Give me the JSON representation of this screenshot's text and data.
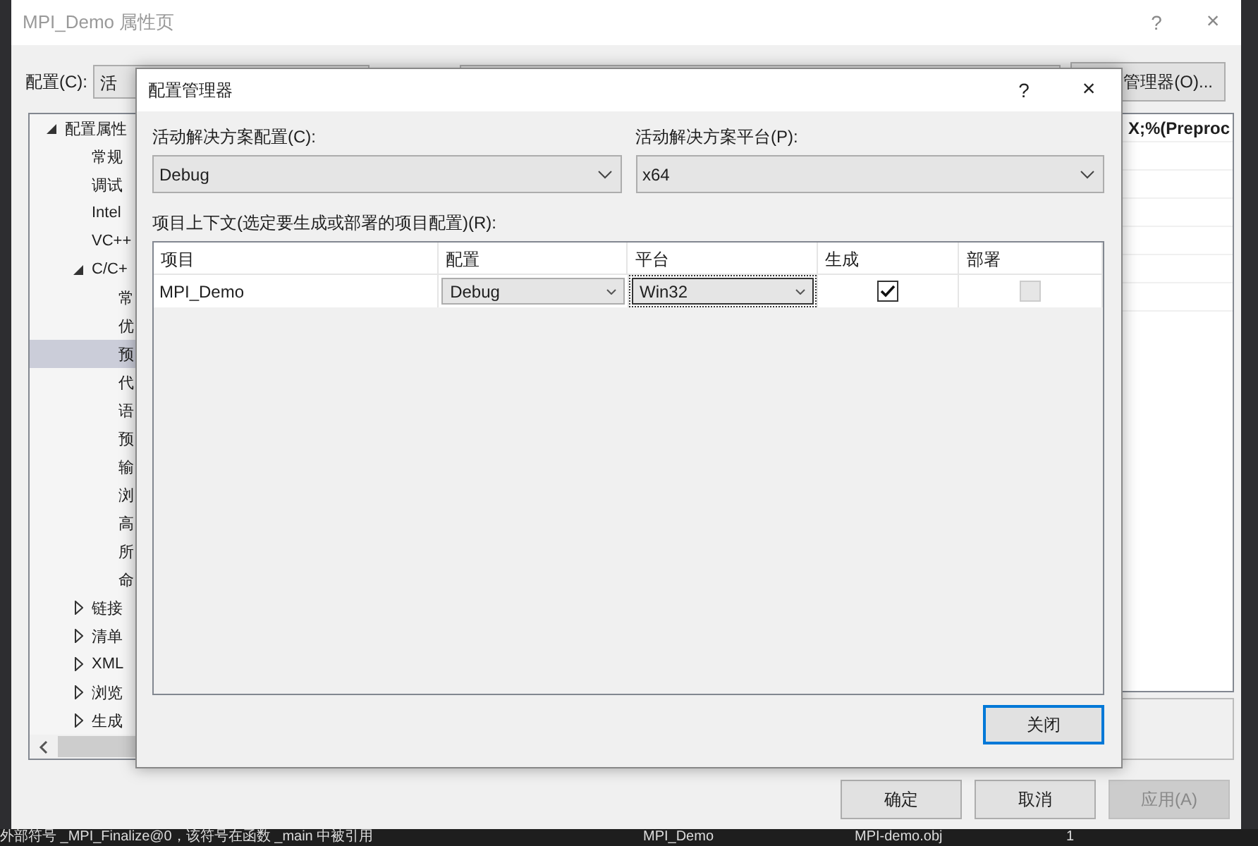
{
  "property_window": {
    "title": "MPI_Demo 属性页",
    "help": "?",
    "close": "×",
    "config_label": "配置(C):",
    "config_combo": "活",
    "config_manager_button": "管理器(O)...",
    "tree": [
      {
        "label": "配置属性",
        "expanded": true,
        "selected": false,
        "children": [
          {
            "label": "常规",
            "selected": false
          },
          {
            "label": "调试",
            "selected": false
          },
          {
            "label": "Intel",
            "selected": false
          },
          {
            "label": "VC++",
            "selected": false
          },
          {
            "label": "C/C+",
            "expanded": true,
            "selected": false,
            "children": [
              {
                "label": "常",
                "selected": false
              },
              {
                "label": "优",
                "selected": false
              },
              {
                "label": "预",
                "selected": true
              },
              {
                "label": "代",
                "selected": false
              },
              {
                "label": "语",
                "selected": false
              },
              {
                "label": "预",
                "selected": false
              },
              {
                "label": "输",
                "selected": false
              },
              {
                "label": "浏",
                "selected": false
              },
              {
                "label": "高",
                "selected": false
              },
              {
                "label": "所",
                "selected": false
              },
              {
                "label": "命",
                "selected": false
              }
            ]
          },
          {
            "label": "链接",
            "expanded": false,
            "selected": false
          },
          {
            "label": "清单",
            "expanded": false,
            "selected": false
          },
          {
            "label": "XML",
            "expanded": false,
            "selected": false
          },
          {
            "label": "浏览",
            "expanded": false,
            "selected": false
          },
          {
            "label": "生成",
            "expanded": false,
            "selected": false
          }
        ]
      }
    ],
    "grid_fragment": "X;%(Preproc",
    "buttons": [
      {
        "label": "确定",
        "disabled": false
      },
      {
        "label": "取消",
        "disabled": false
      },
      {
        "label": "应用(A)",
        "disabled": true
      }
    ]
  },
  "dialog": {
    "title": "配置管理器",
    "help": "?",
    "close": "×",
    "config_label": "活动解决方案配置(C):",
    "config_value": "Debug",
    "platform_label": "活动解决方案平台(P):",
    "platform_value": "x64",
    "context_label": "项目上下文(选定要生成或部署的项目配置)(R):",
    "columns": [
      "项目",
      "配置",
      "平台",
      "生成",
      "部署"
    ],
    "rows": [
      [
        {
          "kind": "text",
          "value": "MPI_Demo"
        },
        {
          "kind": "combo",
          "value": "Debug",
          "focused": false
        },
        {
          "kind": "combo",
          "value": "Win32",
          "focused": true
        },
        {
          "kind": "checkbox",
          "checked": true,
          "disabled": false
        },
        {
          "kind": "checkbox",
          "checked": false,
          "disabled": true
        }
      ]
    ],
    "close_button": {
      "label": "关闭",
      "default": true
    }
  },
  "output_row": [
    "外部符号 _MPI_Finalize@0，该符号在函数 _main 中被引用",
    "MPI_Demo",
    "MPI-demo.obj",
    "1"
  ]
}
